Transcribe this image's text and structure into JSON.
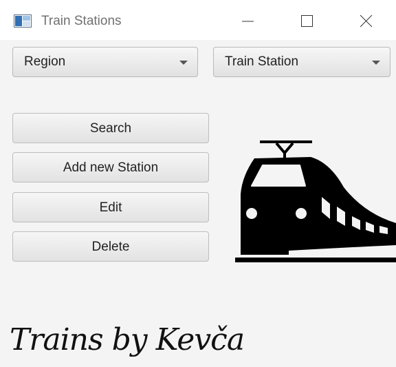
{
  "window": {
    "title": "Train Stations"
  },
  "filters": {
    "region_label": "Region",
    "station_label": "Train Station"
  },
  "actions": {
    "search_label": "Search",
    "add_label": "Add new Station",
    "edit_label": "Edit",
    "delete_label": "Delete"
  },
  "branding": {
    "text": "Trains by Kevča"
  },
  "icons": {
    "app": "app-window-icon",
    "minimize": "minimize-icon",
    "maximize": "maximize-icon",
    "close": "close-icon",
    "dropdown": "chevron-down-icon",
    "illustration": "train-icon"
  },
  "colors": {
    "background": "#f4f4f4",
    "titlebar": "#ffffff",
    "button_border": "#bdbdbd",
    "text": "#222222"
  }
}
